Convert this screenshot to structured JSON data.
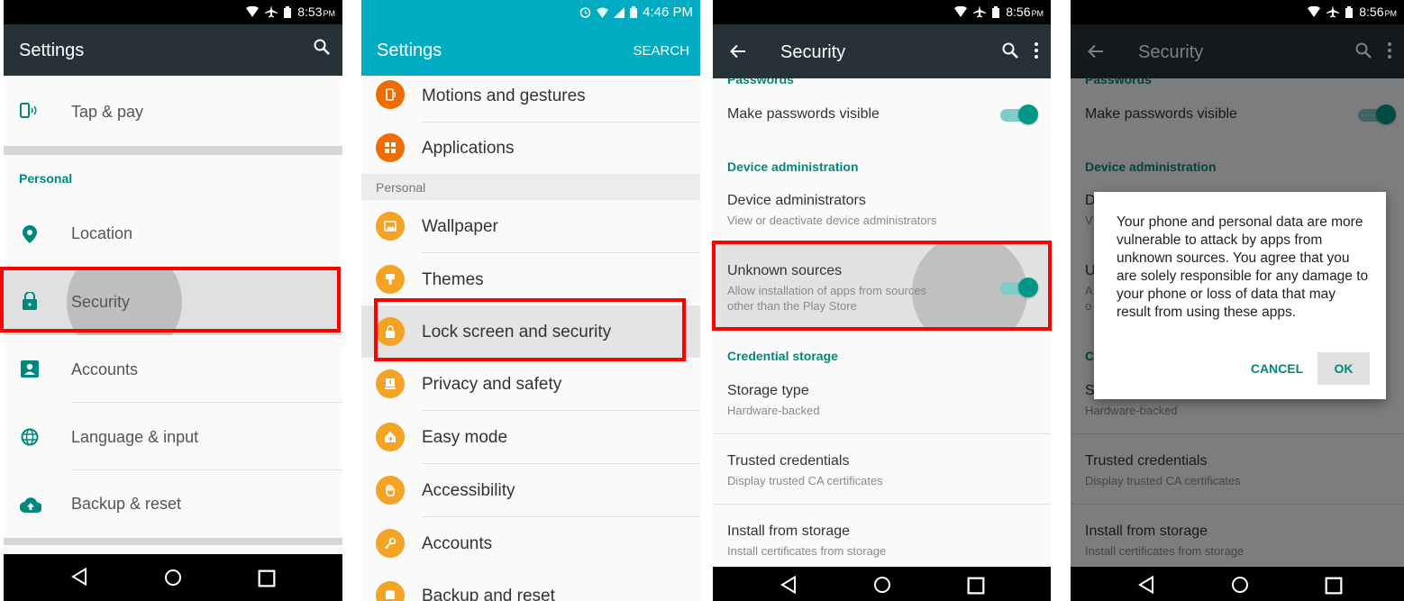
{
  "screen1": {
    "time": "8:53",
    "ampm": "PM",
    "title": "Settings",
    "items": [
      {
        "label": "Tap & pay"
      },
      {
        "header": "Personal"
      },
      {
        "label": "Location"
      },
      {
        "label": "Security"
      },
      {
        "label": "Accounts"
      },
      {
        "label": "Language & input"
      },
      {
        "label": "Backup & reset"
      }
    ]
  },
  "screen2": {
    "time": "4:46 PM",
    "title": "Settings",
    "search": "SEARCH",
    "header": "Personal",
    "items": [
      {
        "label": "Motions and gestures",
        "color": "#ef6c00"
      },
      {
        "label": "Applications",
        "color": "#ef6c00"
      },
      {
        "label": "Wallpaper",
        "color": "#f4a325"
      },
      {
        "label": "Themes",
        "color": "#f4a325"
      },
      {
        "label": "Lock screen and security",
        "color": "#f4a325"
      },
      {
        "label": "Privacy and safety",
        "color": "#f4a325"
      },
      {
        "label": "Easy mode",
        "color": "#f4a325"
      },
      {
        "label": "Accessibility",
        "color": "#f4a325"
      },
      {
        "label": "Accounts",
        "color": "#f4a325"
      },
      {
        "label": "Backup and reset",
        "color": "#f4a325"
      }
    ]
  },
  "screen3": {
    "time": "8:56",
    "ampm": "PM",
    "title": "Security",
    "partial_header": "Passwords",
    "make_visible": "Make passwords visible",
    "device_admin_header": "Device administration",
    "device_admins": "Device administrators",
    "device_admins_sub": "View or deactivate device administrators",
    "unknown_sources": "Unknown sources",
    "unknown_sources_sub1": "Allow installation of apps from sources",
    "unknown_sources_sub2": "other than the Play Store",
    "credential_header": "Credential storage",
    "storage_type": "Storage type",
    "storage_type_sub": "Hardware-backed",
    "trusted": "Trusted credentials",
    "trusted_sub": "Display trusted CA certificates",
    "install": "Install from storage",
    "install_sub": "Install certificates from storage"
  },
  "screen4": {
    "time": "8:56",
    "ampm": "PM",
    "title": "Security",
    "partial_header": "Passwords",
    "make_visible": "Make passwords visible",
    "device_admin_header": "Device administration",
    "storage_type_sub": "Hardware-backed",
    "trusted": "Trusted credentials",
    "trusted_sub": "Display trusted CA certificates",
    "install": "Install from storage",
    "install_sub": "Install certificates from storage",
    "peek_d": "D",
    "peek_v": "V",
    "peek_u": "U",
    "peek_a": "A",
    "peek_o": "o",
    "peek_c": "C",
    "peek_s": "S",
    "dialog": {
      "message": "Your phone and personal data are more vulnerable to attack by apps from unknown sources. You agree that you are solely responsible for any damage to your phone or loss of data that may result from using these apps.",
      "cancel": "CANCEL",
      "ok": "OK"
    }
  },
  "colors": {
    "accent": "#009688",
    "samsung_bar": "#00acc1",
    "highlight": "#ff0000"
  }
}
